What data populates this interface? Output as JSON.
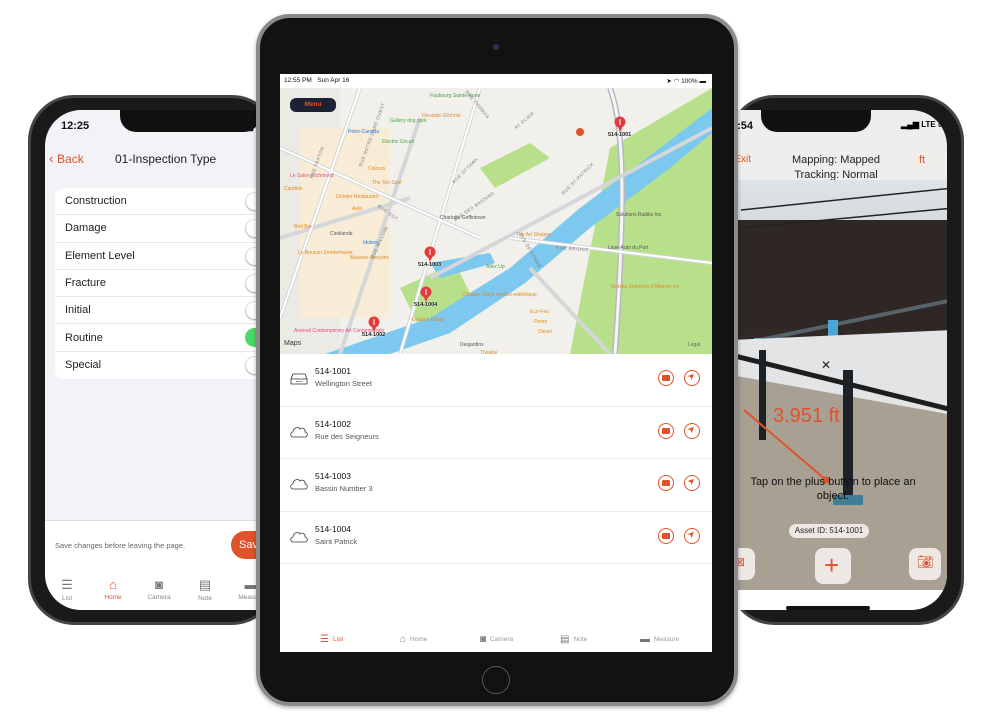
{
  "left_phone": {
    "status_time": "12:25",
    "nav": {
      "back_label": "Back",
      "title": "01-Inspection Type"
    },
    "options": [
      {
        "label": "Construction",
        "on": false
      },
      {
        "label": "Damage",
        "on": false
      },
      {
        "label": "Element Level",
        "on": false
      },
      {
        "label": "Fracture",
        "on": false
      },
      {
        "label": "Initial",
        "on": false
      },
      {
        "label": "Routine",
        "on": true
      },
      {
        "label": "Special",
        "on": false
      }
    ],
    "save_hint": "Save changes before leaving the page.",
    "save_label": "Save",
    "tabs": [
      {
        "label": "List",
        "icon": "list-icon",
        "active": false
      },
      {
        "label": "Home",
        "icon": "home-icon",
        "active": true
      },
      {
        "label": "Camera",
        "icon": "camera-icon",
        "active": false
      },
      {
        "label": "Note",
        "icon": "note-icon",
        "active": false
      },
      {
        "label": "Measure",
        "icon": "ruler-icon",
        "active": false
      }
    ]
  },
  "ipad": {
    "status": {
      "time": "12:55 PM",
      "date": "Sun Apr 16",
      "battery": "100%"
    },
    "menu_label": "Menu",
    "map": {
      "attribution": "Maps",
      "legal": "Legal",
      "pois": [
        {
          "name": "Petro-Canada",
          "kind": "b"
        },
        {
          "name": "Colours",
          "kind": ""
        },
        {
          "name": "The Ten Spot",
          "kind": ""
        },
        {
          "name": "Le Salon Richmond",
          "kind": "p"
        },
        {
          "name": "Candide",
          "kind": ""
        },
        {
          "name": "Grinder Restaurant",
          "kind": ""
        },
        {
          "name": "Ayla",
          "kind": ""
        },
        {
          "name": "Bird Bar",
          "kind": ""
        },
        {
          "name": "Cinélande",
          "kind": "s"
        },
        {
          "name": "Idolem",
          "kind": "b"
        },
        {
          "name": "Le Boucan Smokehouse",
          "kind": ""
        },
        {
          "name": "Mauvais Garçons",
          "kind": ""
        },
        {
          "name": "Arsenal Contemporary Art Contemporain",
          "kind": "p"
        },
        {
          "name": "Fleuriste Gilchrist",
          "kind": ""
        },
        {
          "name": "Charlotte Griffintown",
          "kind": "s"
        },
        {
          "name": "Gallery dog park",
          "kind": "g"
        },
        {
          "name": "Electric Circuit",
          "kind": "g"
        },
        {
          "name": "Faubourg Sainte-Anne",
          "kind": "g"
        },
        {
          "name": "Solutions Rubiks Inc.",
          "kind": "s"
        },
        {
          "name": "The Art Shoppe",
          "kind": ""
        },
        {
          "name": "Lave-Auto du Port",
          "kind": "s"
        },
        {
          "name": "Allez Up",
          "kind": "g"
        },
        {
          "name": "Clinique Chloé médico-esthétique",
          "kind": ""
        },
        {
          "name": "Toshiba Solutions d'Affaires Inc",
          "kind": ""
        },
        {
          "name": "Eco-Feu",
          "kind": ""
        },
        {
          "name": "Perez",
          "kind": ""
        },
        {
          "name": "Diesel",
          "kind": ""
        },
        {
          "name": "Gestion Patlav",
          "kind": ""
        },
        {
          "name": "Desjardins",
          "kind": "s"
        },
        {
          "name": "Théâtre",
          "kind": ""
        }
      ],
      "roads": [
        "RUE NOTRE-DAME OUEST",
        "RUE PAXTON",
        "RUE GUY",
        "RUE WILLIAM",
        "RUE OTTAWA",
        "RUE DES BASSINS",
        "RUE ST-PATRICK",
        "RUE BRIDGE",
        "RUE DE CONDÉ",
        "RUE RICHMOND",
        "RUE THOMAS",
        "AV OLIER"
      ],
      "pins": [
        "514-1001",
        "514-1002",
        "514-1003",
        "514-1004"
      ]
    },
    "assets": [
      {
        "id": "514-1001",
        "location": "Wellington Street",
        "icon": "device-icon"
      },
      {
        "id": "514-1002",
        "location": "Rue des Seigneurs",
        "icon": "cloud-icon"
      },
      {
        "id": "514-1003",
        "location": "Bassin Number 3",
        "icon": "cloud-icon"
      },
      {
        "id": "514-1004",
        "location": "Saint Patrick",
        "icon": "cloud-icon"
      }
    ],
    "tabs": [
      {
        "label": "List",
        "active": true
      },
      {
        "label": "Home",
        "active": false
      },
      {
        "label": "Camera",
        "active": false
      },
      {
        "label": "Note",
        "active": false
      },
      {
        "label": "Measure",
        "active": false
      }
    ]
  },
  "right_phone": {
    "status_time": "9:54",
    "network": "LTE",
    "exit_label": "Exit",
    "unit_label": "ft",
    "mapping_status": "Mapping: Mapped",
    "tracking_status": "Tracking: Normal",
    "measurement": "3.951 ft",
    "hint": "Tap on the plus button to place an object.",
    "asset_id": "Asset ID: 514-1001"
  },
  "colors": {
    "accent": "#e0532a",
    "toggle_on": "#4cd964",
    "water": "#7cc8ef",
    "park": "#b8e08a"
  }
}
